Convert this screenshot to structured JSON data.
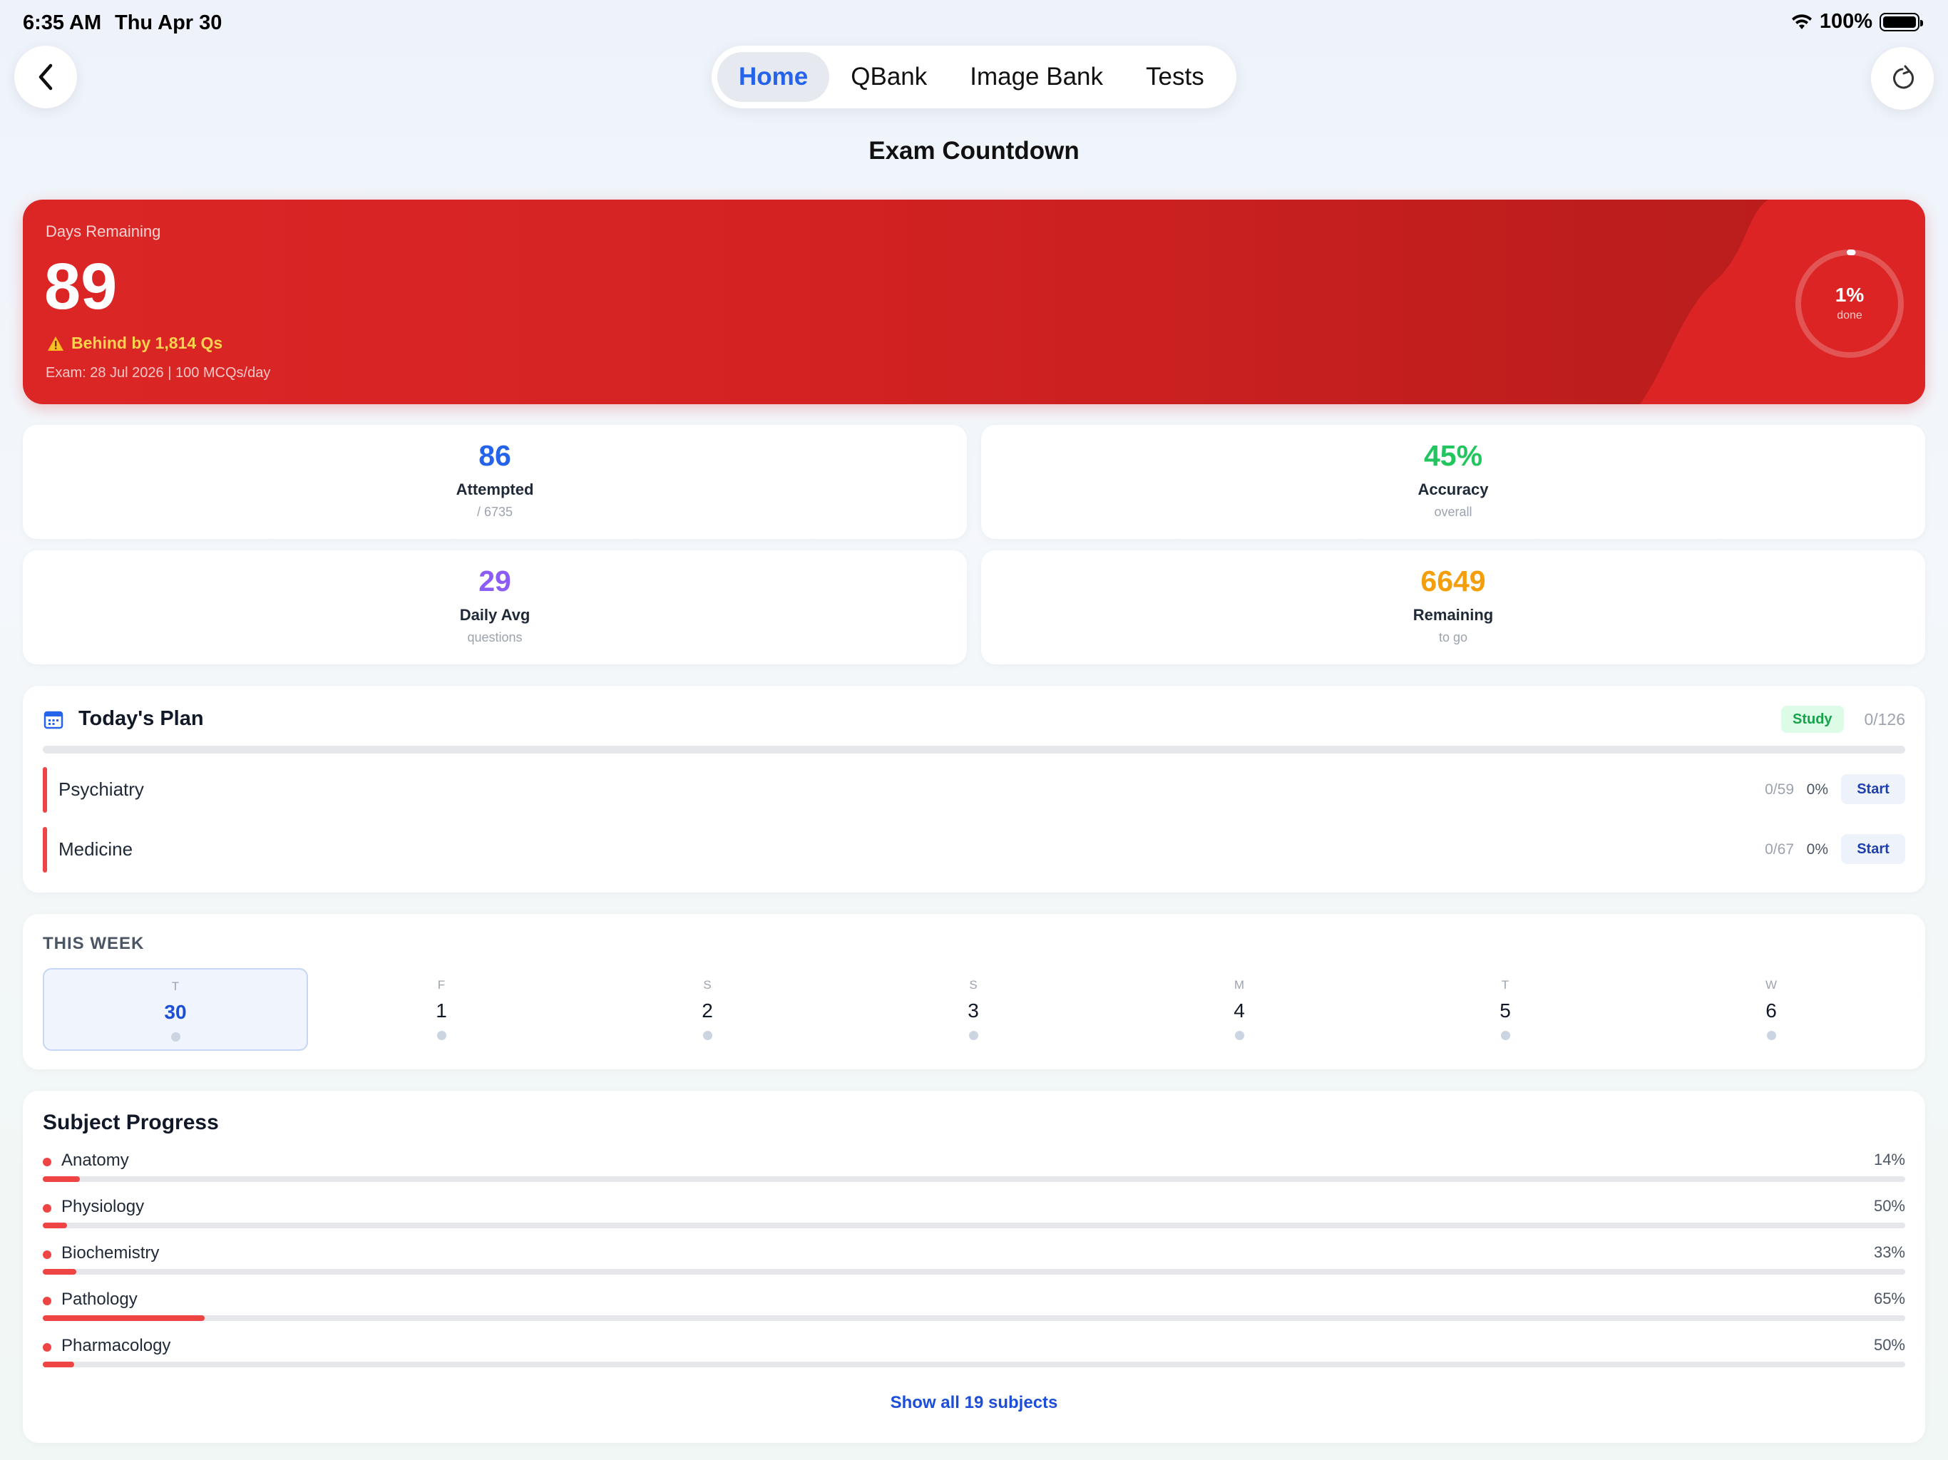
{
  "status": {
    "time": "6:35 AM",
    "date": "Thu Apr 30",
    "battery": "100%"
  },
  "tabs": [
    {
      "label": "Home",
      "active": true
    },
    {
      "label": "QBank",
      "active": false
    },
    {
      "label": "Image Bank",
      "active": false
    },
    {
      "label": "Tests",
      "active": false
    }
  ],
  "page_title": "Exam Countdown",
  "hero": {
    "label": "Days Remaining",
    "days": "89",
    "warning": "Behind by 1,814 Qs",
    "exam_info": "Exam: 28 Jul 2026 | 100 MCQs/day",
    "progress_label": "1%",
    "progress_sub": "done",
    "progress_fraction": 0.01
  },
  "stats": [
    {
      "value": "86",
      "name": "Attempted",
      "sub": "/ 6735",
      "color": "#2563eb"
    },
    {
      "value": "45%",
      "name": "Accuracy",
      "sub": "overall",
      "color": "#22c55e"
    },
    {
      "value": "29",
      "name": "Daily Avg",
      "sub": "questions",
      "color": "#8b5cf6"
    },
    {
      "value": "6649",
      "name": "Remaining",
      "sub": "to go",
      "color": "#f59e0b"
    }
  ],
  "plan": {
    "title": "Today's Plan",
    "badge": "Study",
    "count": "0/126",
    "items": [
      {
        "name": "Psychiatry",
        "frac": "0/59",
        "pct": "0%",
        "action": "Start"
      },
      {
        "name": "Medicine",
        "frac": "0/67",
        "pct": "0%",
        "action": "Start"
      }
    ]
  },
  "week": {
    "title": "THIS WEEK",
    "days": [
      {
        "letter": "T",
        "num": "30",
        "selected": true
      },
      {
        "letter": "F",
        "num": "1",
        "selected": false
      },
      {
        "letter": "S",
        "num": "2",
        "selected": false
      },
      {
        "letter": "S",
        "num": "3",
        "selected": false
      },
      {
        "letter": "M",
        "num": "4",
        "selected": false
      },
      {
        "letter": "T",
        "num": "5",
        "selected": false
      },
      {
        "letter": "W",
        "num": "6",
        "selected": false
      }
    ]
  },
  "subjects": {
    "title": "Subject Progress",
    "items": [
      {
        "name": "Anatomy",
        "pct": "14%",
        "progress": 0.02
      },
      {
        "name": "Physiology",
        "pct": "50%",
        "progress": 0.013
      },
      {
        "name": "Biochemistry",
        "pct": "33%",
        "progress": 0.018
      },
      {
        "name": "Pathology",
        "pct": "65%",
        "progress": 0.087
      },
      {
        "name": "Pharmacology",
        "pct": "50%",
        "progress": 0.017
      }
    ],
    "show_all": "Show all 19 subjects"
  },
  "colors": {
    "accent": "#2563eb",
    "danger": "#dc2626",
    "warn": "#fcd34d"
  }
}
